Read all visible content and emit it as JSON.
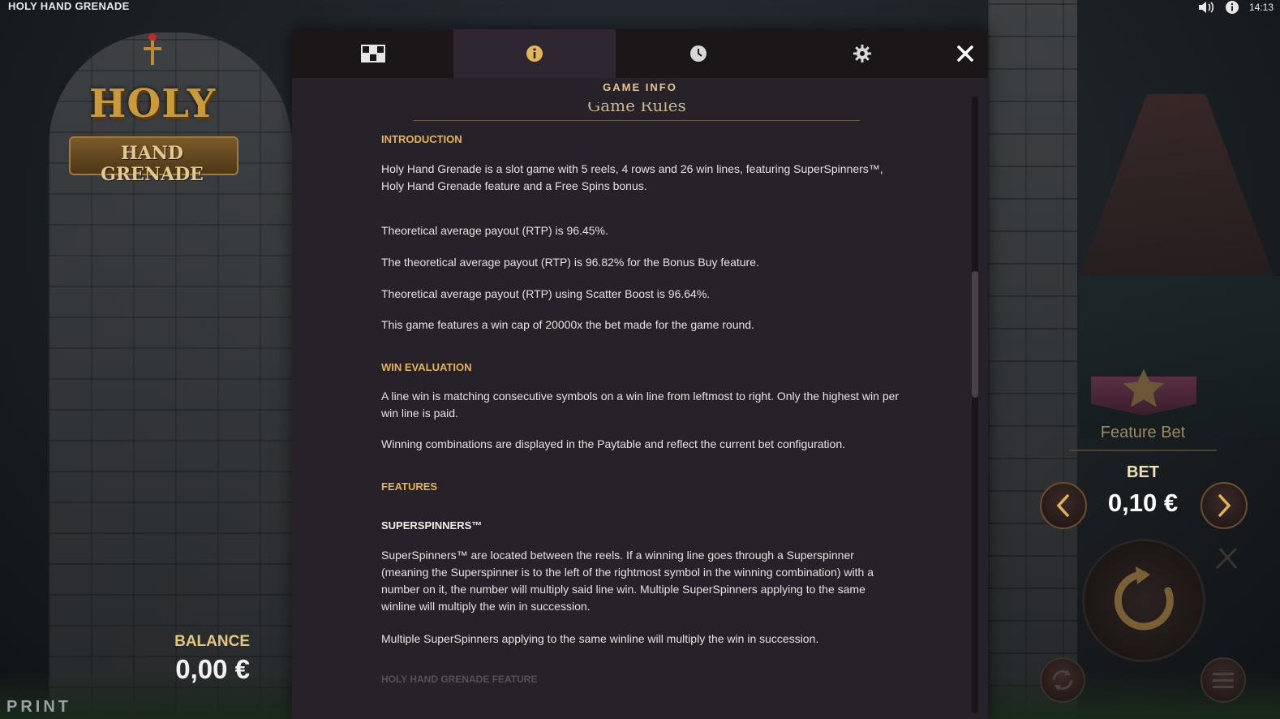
{
  "app": {
    "title": "HOLY HAND GRENADE",
    "time": "14:13"
  },
  "logo": {
    "line1": "HOLY",
    "line2": "HAND GRENADE"
  },
  "balance": {
    "label": "BALANCE",
    "value": "0,00 €"
  },
  "print_label": "PRINT",
  "controls": {
    "feature_bet_label": "Feature Bet",
    "bet_label": "BET",
    "bet_value": "0,10 €"
  },
  "modal": {
    "tabs": [
      {
        "name": "paytable",
        "icon": "grid-icon"
      },
      {
        "name": "info",
        "icon": "info-icon",
        "active": true
      },
      {
        "name": "history",
        "icon": "clock-icon"
      },
      {
        "name": "settings",
        "icon": "gear-icon"
      }
    ],
    "section_title": "GAME INFO",
    "heading": "Game Rules",
    "introduction": {
      "title": "INTRODUCTION",
      "p1": "Holy Hand Grenade is a slot game with 5 reels, 4 rows and 26 win lines, featuring SuperSpinners™, Holy Hand Grenade feature and a Free Spins bonus.",
      "p2": "Theoretical average payout (RTP) is 96.45%.",
      "p3": "The theoretical average payout (RTP) is 96.82% for the Bonus Buy feature.",
      "p4": "Theoretical average payout (RTP) using Scatter Boost is 96.64%.",
      "p5": "This game features a win cap of 20000x the bet made for the game round."
    },
    "win_evaluation": {
      "title": "WIN EVALUATION",
      "p1": "A line win is matching consecutive symbols on a win line from leftmost to right. Only the highest win per win line is paid.",
      "p2": "Winning combinations are displayed in the Paytable and reflect the current bet configuration."
    },
    "features": {
      "title": "FEATURES",
      "superspinners_title": "SUPERSPINNERS™",
      "p1": "SuperSpinners™ are located between the reels. If a winning line goes through a Superspinner (meaning the Superspinner is to the left of the rightmost symbol in the winning combination) with a number on it, the number will multiply said line win. Multiple SuperSpinners applying to the same winline will multiply the win in succession.",
      "p2": "Multiple SuperSpinners applying to the same winline will multiply the win in succession.",
      "next_title": "HOLY HAND GRENADE FEATURE"
    }
  },
  "colors": {
    "accent": "#e3b45a",
    "panel": "#272129",
    "tab_bg": "#1b1719"
  }
}
